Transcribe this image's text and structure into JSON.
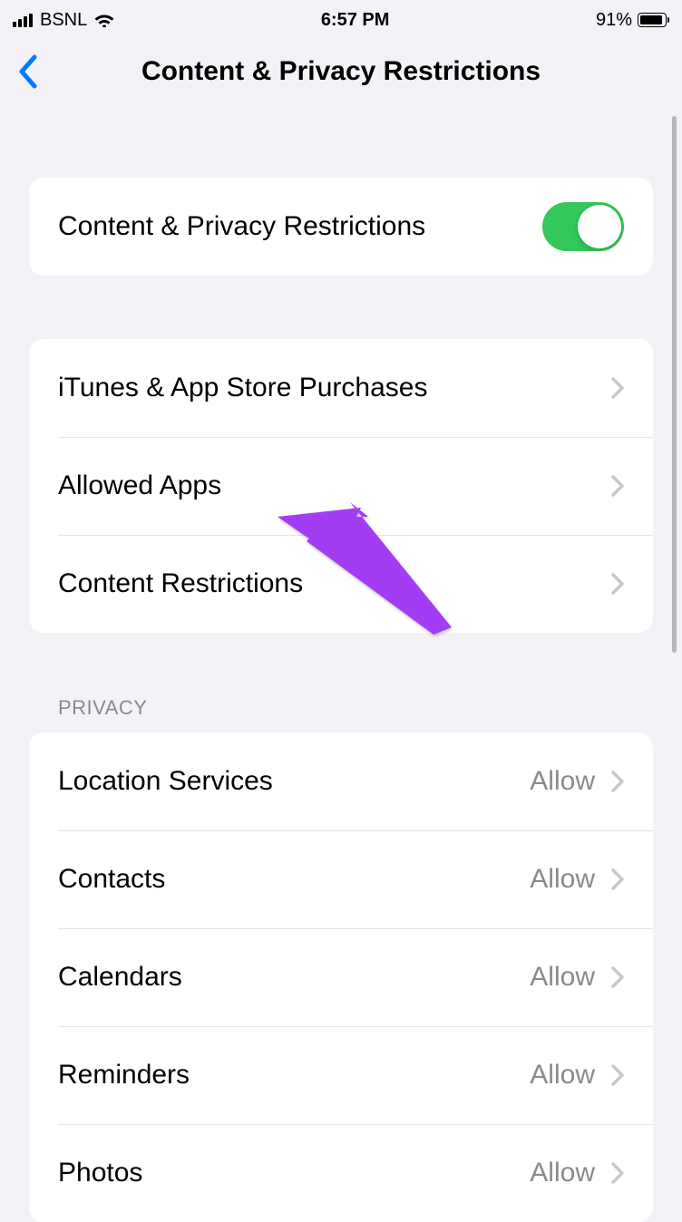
{
  "statusBar": {
    "carrier": "BSNL",
    "time": "6:57 PM",
    "batteryPercent": "91%"
  },
  "header": {
    "title": "Content & Privacy Restrictions"
  },
  "toggleRow": {
    "label": "Content & Privacy Restrictions",
    "enabled": true
  },
  "section1": {
    "items": [
      {
        "label": "iTunes & App Store Purchases"
      },
      {
        "label": "Allowed Apps"
      },
      {
        "label": "Content Restrictions"
      }
    ]
  },
  "privacySection": {
    "header": "PRIVACY",
    "items": [
      {
        "label": "Location Services",
        "value": "Allow"
      },
      {
        "label": "Contacts",
        "value": "Allow"
      },
      {
        "label": "Calendars",
        "value": "Allow"
      },
      {
        "label": "Reminders",
        "value": "Allow"
      },
      {
        "label": "Photos",
        "value": "Allow"
      }
    ]
  }
}
